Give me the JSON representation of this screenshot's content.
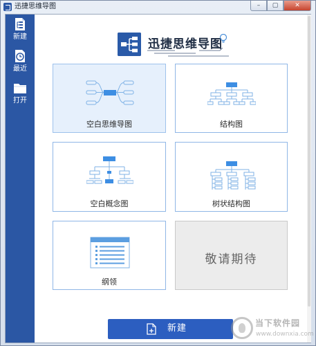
{
  "window": {
    "title": "迅捷思维导图",
    "buttons": {
      "minimize": "–",
      "maximize": "▢",
      "close": "✕"
    }
  },
  "sidebar": {
    "items": [
      {
        "label": "新建",
        "icon": "new-file-icon"
      },
      {
        "label": "最近",
        "icon": "clock-icon"
      },
      {
        "label": "打开",
        "icon": "folder-icon"
      }
    ]
  },
  "header": {
    "brand": "迅捷思维导图",
    "logo_icon": "mindmap-logo-icon"
  },
  "templates": [
    {
      "label": "空白思维导图",
      "icon": "blank-mindmap-thumbnail"
    },
    {
      "label": "结构图",
      "icon": "structure-chart-thumbnail"
    },
    {
      "label": "空白概念图",
      "icon": "concept-map-thumbnail"
    },
    {
      "label": "树状结构图",
      "icon": "tree-chart-thumbnail"
    },
    {
      "label": "纲领",
      "icon": "outline-thumbnail"
    },
    {
      "label": "敬请期待",
      "icon": ""
    }
  ],
  "footer": {
    "new_button": "新建"
  },
  "watermark": {
    "brand": "当下软件园",
    "url": "www.downxia.com"
  },
  "colors": {
    "sidebar": "#2b57a4",
    "accent": "#2c5ec0",
    "card_border": "#8fb6e6",
    "selected": "#e6f0fc",
    "diagram": "#5b9ee0"
  }
}
